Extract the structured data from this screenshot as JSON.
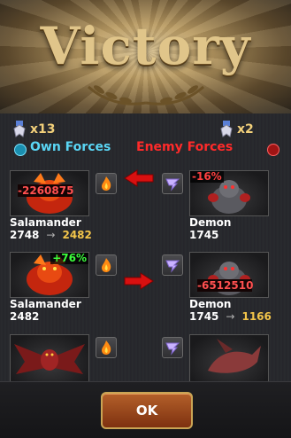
{
  "title": "Victory",
  "own": {
    "count": "x13",
    "label": "Own Forces",
    "color": "#5ad6f5"
  },
  "enemy": {
    "count": "x2",
    "label": "Enemy Forces",
    "color": "#ff2a2a"
  },
  "rows": [
    {
      "left": {
        "name": "Salamander",
        "stat_old": "2748",
        "stat_new": "2482",
        "damage": "-2260875"
      },
      "right": {
        "name": "Demon",
        "stat": "1745",
        "percent": "-16%"
      },
      "direction": "left"
    },
    {
      "left": {
        "name": "Salamander",
        "stat": "2482",
        "percent": "+76%"
      },
      "right": {
        "name": "Demon",
        "stat_old": "1745",
        "stat_new": "1166",
        "damage": "-6512510"
      },
      "direction": "right"
    }
  ],
  "ok_label": "OK",
  "icons": {
    "rank": "rank-badge-icon",
    "own_eye": "cyan-eye-icon",
    "enemy_eye": "red-eye-icon",
    "fire": "fire-element-icon",
    "wind": "wind-element-icon"
  }
}
